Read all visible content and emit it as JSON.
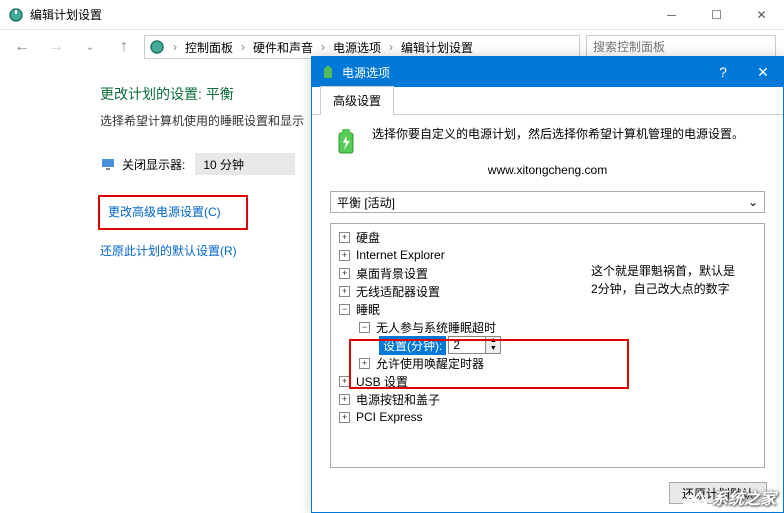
{
  "titlebar": {
    "title": "编辑计划设置"
  },
  "breadcrumb": {
    "items": [
      "控制面板",
      "硬件和声音",
      "电源选项",
      "编辑计划设置"
    ]
  },
  "search": {
    "placeholder": "搜索控制面板"
  },
  "content": {
    "heading": "更改计划的设置: 平衡",
    "subheading": "选择希望计算机使用的睡眠设置和显示",
    "display_off_label": "关闭显示器:",
    "display_off_value": "10 分钟",
    "advanced_link": "更改高级电源设置(C)",
    "restore_link": "还原此计划的默认设置(R)"
  },
  "dialog": {
    "title": "电源选项",
    "tab": "高级设置",
    "description": "选择你要自定义的电源计划，然后选择你希望计算机管理的电源设置。",
    "url": "www.xitongcheng.com",
    "plan": "平衡 [活动]",
    "tree": {
      "hdd": "硬盘",
      "ie": "Internet Explorer",
      "desktop_bg": "桌面背景设置",
      "wireless": "无线适配器设置",
      "sleep": "睡眠",
      "unattended": "无人参与系统睡眠超时",
      "setting_label": "设置(分钟):",
      "setting_value": "2",
      "wake_timers": "允许使用唤醒定时器",
      "usb": "USB 设置",
      "power_buttons": "电源按钮和盖子",
      "pci": "PCI Express"
    },
    "annotation_line1": "这个就是罪魁祸首，默认是",
    "annotation_line2": "2分钟，自己改大点的数字",
    "restore_defaults": "还原计划默认"
  },
  "watermark": "系统之家"
}
